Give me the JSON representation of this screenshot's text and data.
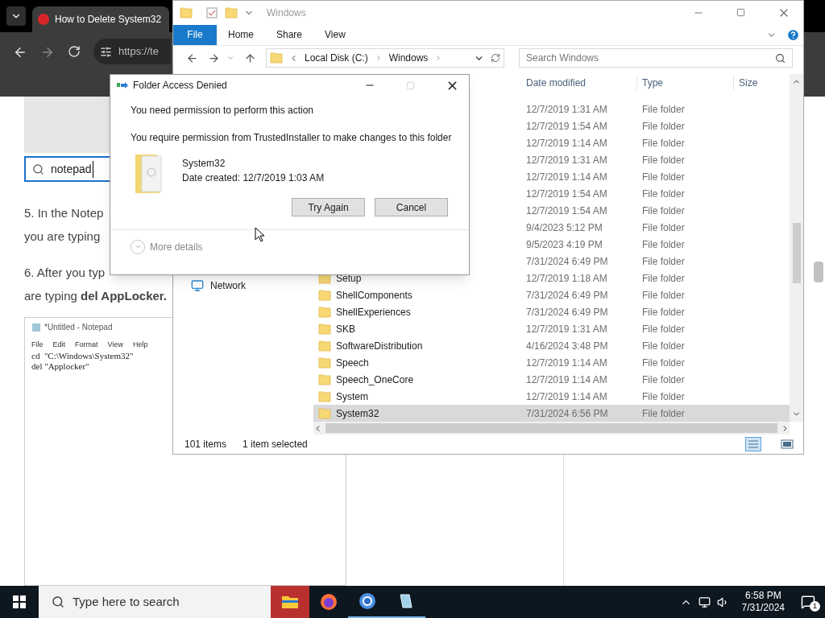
{
  "browser": {
    "tab_title": "How to Delete System32",
    "url": "https://te",
    "article": {
      "search_value": "notepad",
      "paragraphs": [
        [
          "5. In the Notep",
          "you are typing"
        ],
        [
          "6. After you typ",
          "are typing **del AppLocker.**"
        ]
      ],
      "notepad_image": {
        "title": "*Untitled - Notepad",
        "menu": [
          "File",
          "Edit",
          "Format",
          "View",
          "Help"
        ],
        "lines": [
          "cd  \"C:\\Windows\\System32\"",
          "del \"Applocker\""
        ]
      }
    }
  },
  "explorer": {
    "title": "Windows",
    "file_tab": "File",
    "ribbon_tabs": [
      "Home",
      "Share",
      "View"
    ],
    "breadcrumb": [
      "Local Disk (C:)",
      "Windows"
    ],
    "search_placeholder": "Search Windows",
    "columns": [
      "Date modified",
      "Type",
      "Size"
    ],
    "nav_items": [
      "Network"
    ],
    "rows": [
      {
        "date": "12/7/2019 1:31 AM",
        "type": "File folder",
        "selected": false
      },
      {
        "date": "12/7/2019 1:54 AM",
        "type": "File folder",
        "selected": false
      },
      {
        "date": "12/7/2019 1:14 AM",
        "type": "File folder",
        "selected": false
      },
      {
        "date": "12/7/2019 1:31 AM",
        "type": "File folder",
        "selected": false
      },
      {
        "date": "12/7/2019 1:14 AM",
        "type": "File folder",
        "selected": false
      },
      {
        "date": "12/7/2019 1:54 AM",
        "type": "File folder",
        "selected": false
      },
      {
        "date": "12/7/2019 1:54 AM",
        "type": "File folder",
        "selected": false
      },
      {
        "date": "9/4/2023 5:12 PM",
        "type": "File folder",
        "selected": false
      },
      {
        "date": "9/5/2023 4:19 PM",
        "type": "File folder",
        "selected": false
      },
      {
        "date": "7/31/2024 6:49 PM",
        "type": "File folder",
        "selected": false
      },
      {
        "name": "Setup",
        "date": "12/7/2019 1:18 AM",
        "type": "File folder",
        "selected": false
      },
      {
        "name": "ShellComponents",
        "date": "7/31/2024 6:49 PM",
        "type": "File folder",
        "selected": false
      },
      {
        "name": "ShellExperiences",
        "date": "7/31/2024 6:49 PM",
        "type": "File folder",
        "selected": false
      },
      {
        "name": "SKB",
        "date": "12/7/2019 1:31 AM",
        "type": "File folder",
        "selected": false
      },
      {
        "name": "SoftwareDistribution",
        "date": "4/16/2024 3:48 PM",
        "type": "File folder",
        "selected": false
      },
      {
        "name": "Speech",
        "date": "12/7/2019 1:14 AM",
        "type": "File folder",
        "selected": false
      },
      {
        "name": "Speech_OneCore",
        "date": "12/7/2019 1:14 AM",
        "type": "File folder",
        "selected": false
      },
      {
        "name": "System",
        "date": "12/7/2019 1:14 AM",
        "type": "File folder",
        "selected": false
      },
      {
        "name": "System32",
        "date": "7/31/2024 6:56 PM",
        "type": "File folder",
        "selected": true
      }
    ],
    "status": {
      "count": "101 items",
      "selection": "1 item selected"
    }
  },
  "dialog": {
    "title": "Folder Access Denied",
    "message": "You need permission to perform this action",
    "detail": "You require permission from TrustedInstaller to make changes to this folder",
    "folder_name": "System32",
    "folder_date": "Date created: 12/7/2019 1:03 AM",
    "buttons": [
      "Try Again",
      "Cancel"
    ],
    "more_details": "More details"
  },
  "taskbar": {
    "search_placeholder": "Type here to search",
    "apps": [
      {
        "kind": "explorer",
        "highlighted": true,
        "running": false
      },
      {
        "kind": "firefox",
        "highlighted": false,
        "running": false
      },
      {
        "kind": "chrome",
        "highlighted": false,
        "running": true
      },
      {
        "kind": "notepad",
        "highlighted": false,
        "running": true
      }
    ],
    "time": "6:58 PM",
    "date": "7/31/2024",
    "notifications": "1"
  }
}
